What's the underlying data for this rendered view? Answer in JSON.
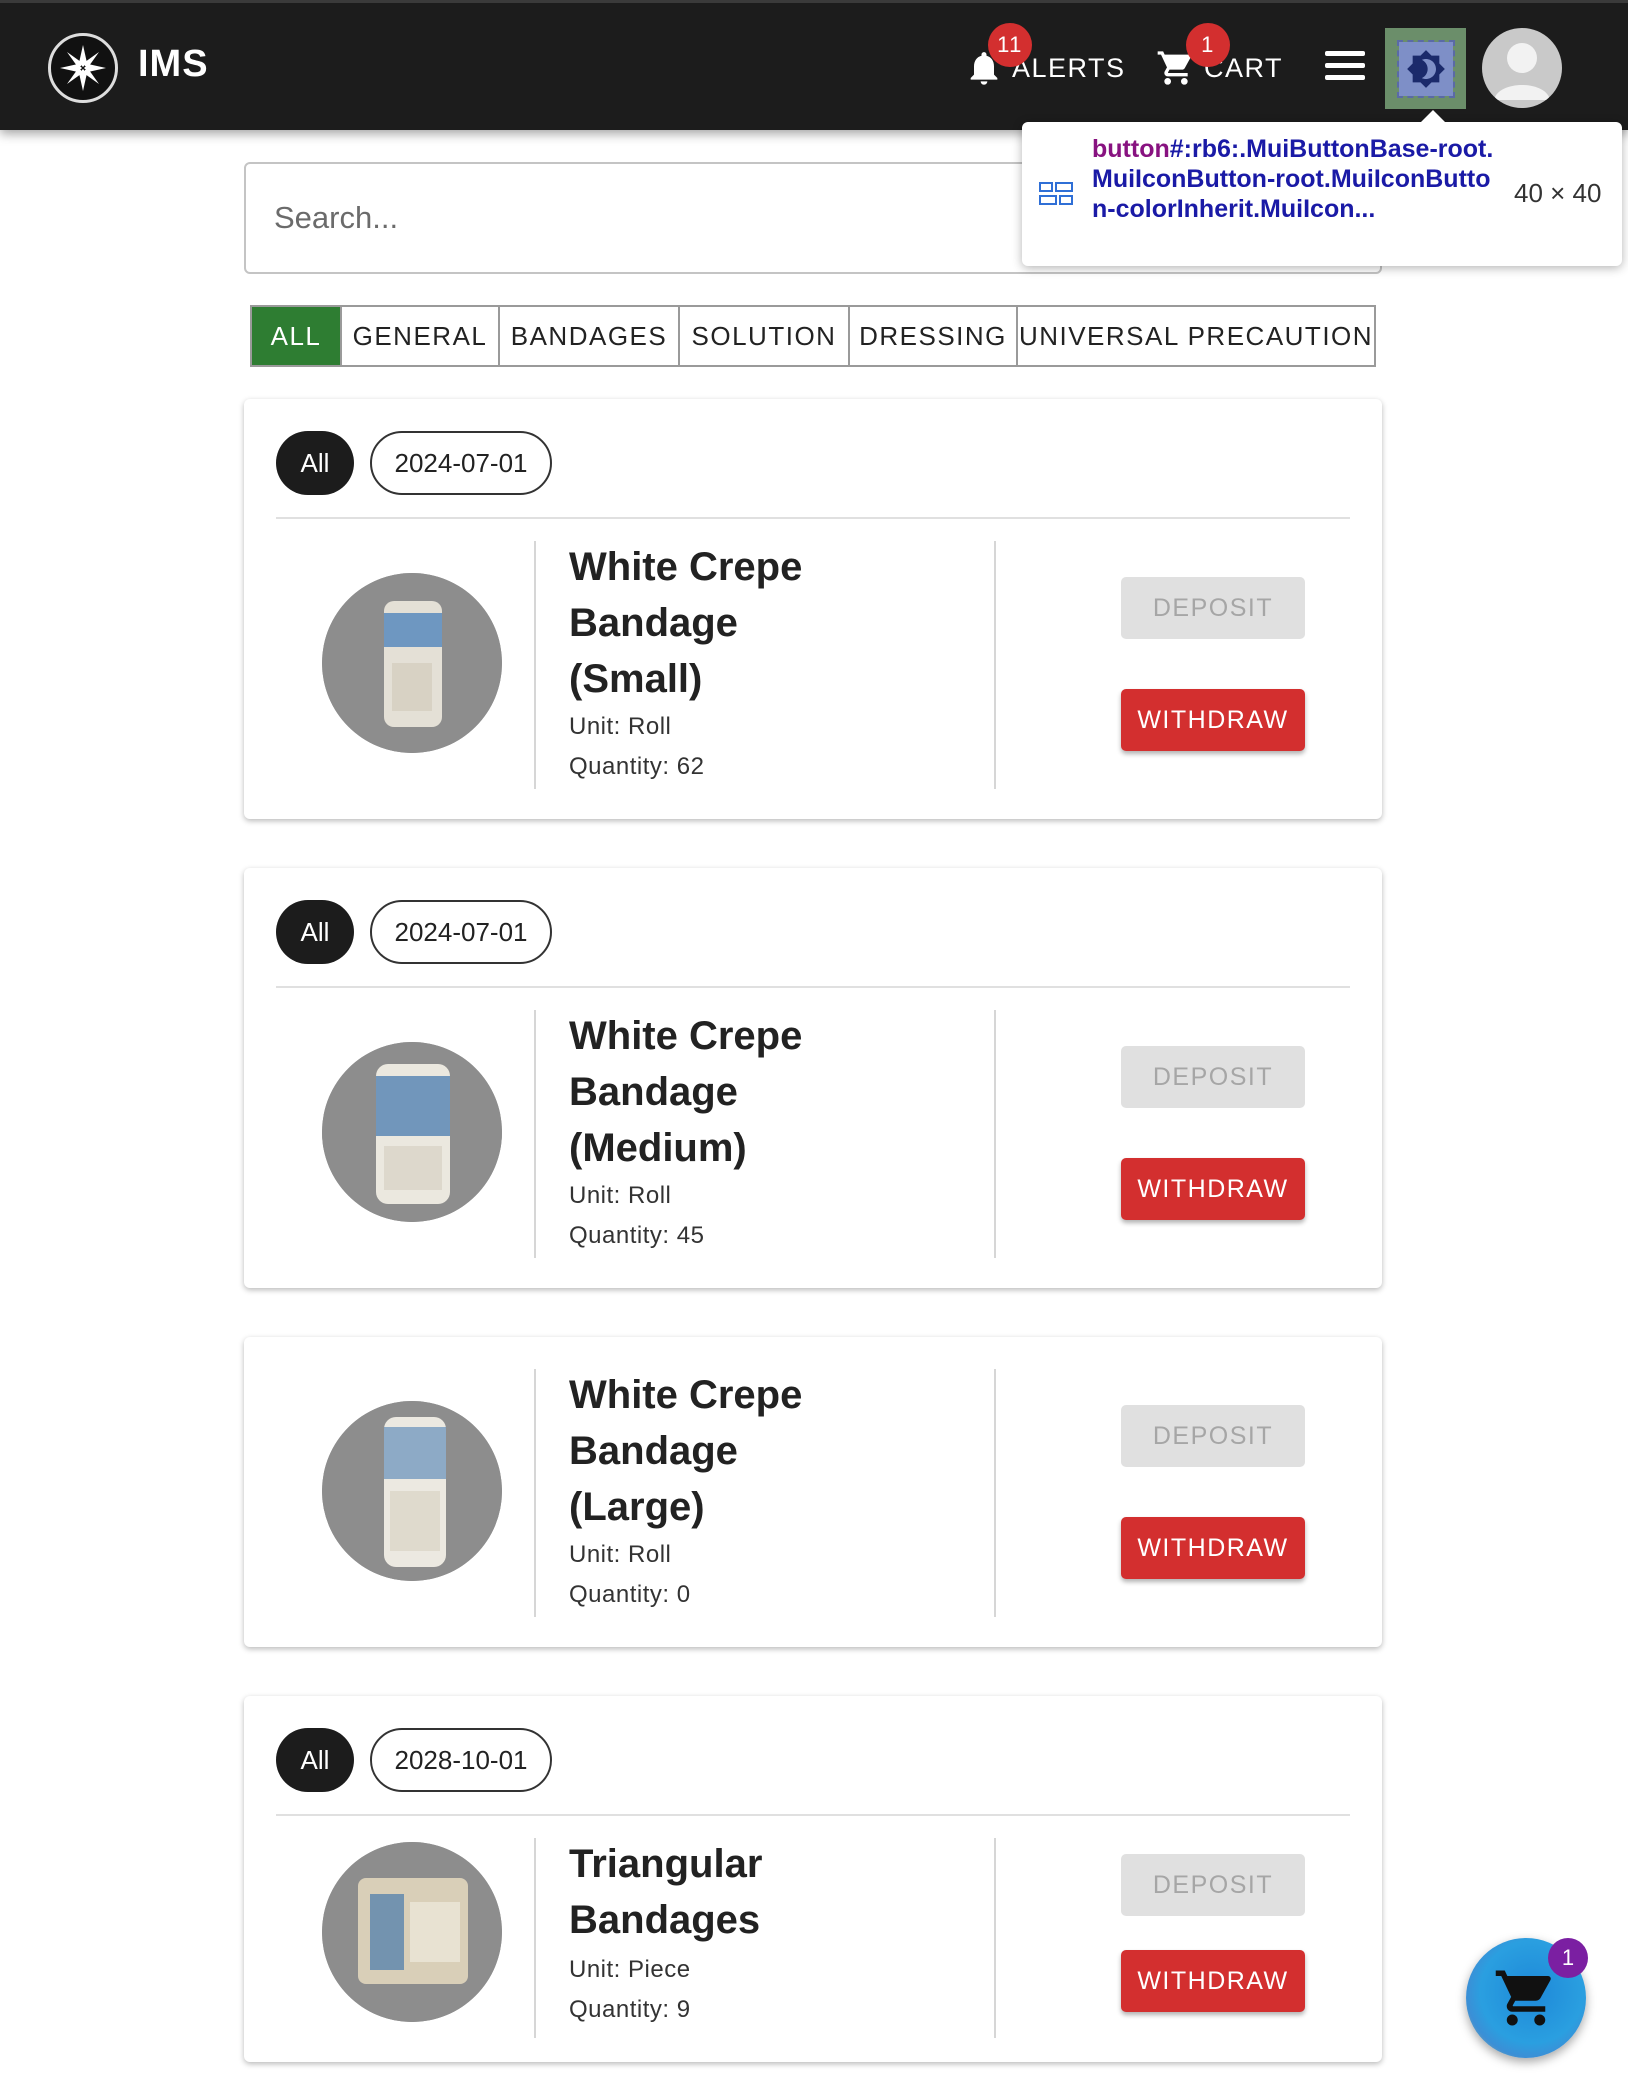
{
  "header": {
    "brand": "IMS",
    "alerts_label": "ALERTS",
    "alerts_count": "11",
    "cart_label": "CART",
    "cart_count": "1"
  },
  "devtools_tooltip": {
    "tag": "button",
    "selector": "#:rb6:.MuiButtonBase-root.MuiIconButton-root.MuiIconButton-colorInherit.MuiIcon...",
    "size": "40 × 40"
  },
  "search": {
    "placeholder": "Search..."
  },
  "filters": [
    "ALL",
    "GENERAL",
    "BANDAGES",
    "SOLUTION",
    "DRESSING",
    "UNIVERSAL PRECAUTION"
  ],
  "active_filter": "ALL",
  "items": [
    {
      "chip_all": "All",
      "date": "2024-07-01",
      "title": "White Crepe Bandage (Small)",
      "unit": "Unit: Roll",
      "quantity": "Quantity: 62",
      "deposit": "DEPOSIT",
      "withdraw": "WITHDRAW"
    },
    {
      "chip_all": "All",
      "date": "2024-07-01",
      "title": "White Crepe Bandage (Medium)",
      "unit": "Unit: Roll",
      "quantity": "Quantity: 45",
      "deposit": "DEPOSIT",
      "withdraw": "WITHDRAW"
    },
    {
      "title": "White Crepe Bandage (Large)",
      "unit": "Unit: Roll",
      "quantity": "Quantity: 0",
      "deposit": "DEPOSIT",
      "withdraw": "WITHDRAW"
    },
    {
      "chip_all": "All",
      "date": "2028-10-01",
      "title": "Triangular Bandages",
      "unit": "Unit: Piece",
      "quantity": "Quantity: 9",
      "deposit": "DEPOSIT",
      "withdraw": "WITHDRAW"
    }
  ],
  "fab": {
    "badge": "1"
  },
  "colors": {
    "appbar": "#1c1c1c",
    "active_filter": "#2e7d32",
    "withdraw": "#d32f2f",
    "badge": "#d32f2f",
    "fab_badge": "#7b1fa2"
  },
  "icons": [
    "logo-cross-icon",
    "bell-icon",
    "cart-icon",
    "menu-icon",
    "theme-toggle-icon",
    "avatar-icon",
    "fab-cart-icon"
  ]
}
